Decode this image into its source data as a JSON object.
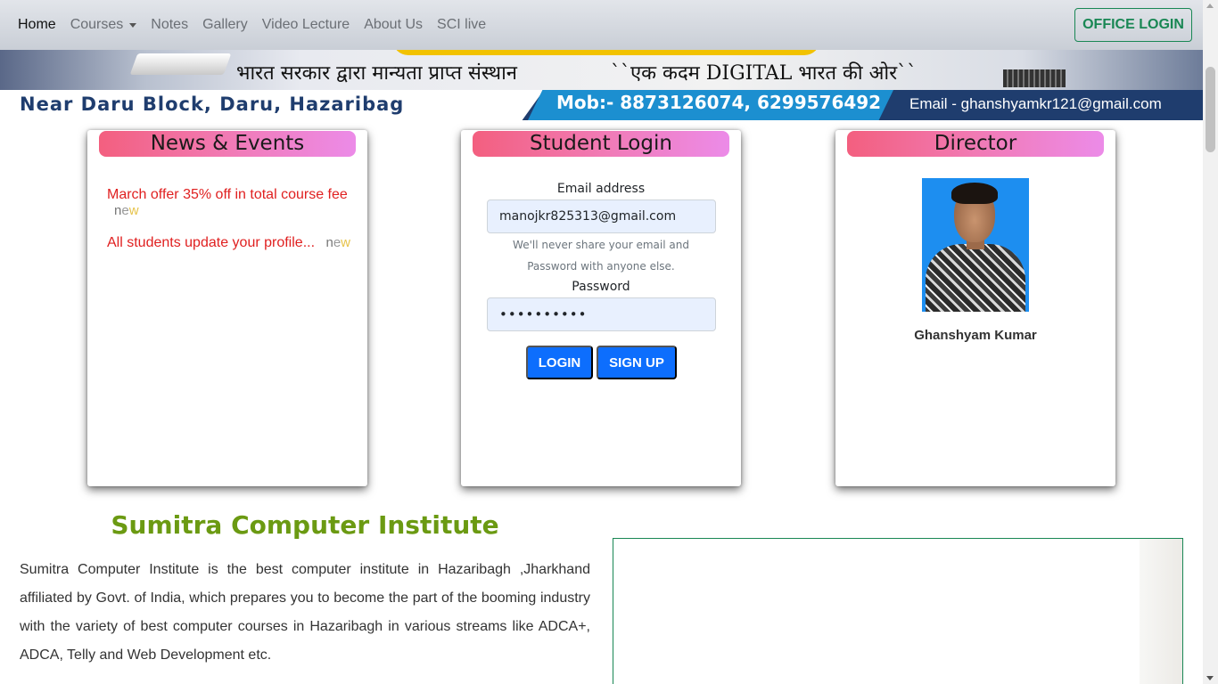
{
  "navbar": {
    "items": [
      {
        "label": "Home",
        "active": true
      },
      {
        "label": "Courses",
        "dropdown": true
      },
      {
        "label": "Notes"
      },
      {
        "label": "Gallery"
      },
      {
        "label": "Video Lecture"
      },
      {
        "label": "About Us"
      },
      {
        "label": "SCI live"
      }
    ],
    "office_login_label": "OFFICE LOGIN"
  },
  "banner": {
    "hindi_left": "भारत सरकार द्वारा मान्यता प्राप्त संस्थान",
    "hindi_right": "``एक कदम DIGITAL भारत की ओर``",
    "address": "Near Daru Block, Daru, Hazaribag",
    "mobile": "Mob:- 8873126074, 6299576492",
    "email": "Email - ghanshyamkr121@gmail.com"
  },
  "news": {
    "title": "News & Events",
    "items": [
      {
        "text": "March offer 35% off in total course fee",
        "tag": "new"
      },
      {
        "text": "All students update your profile...",
        "tag": "new"
      }
    ]
  },
  "login": {
    "title": "Student Login",
    "email_label": "Email address",
    "email_value": "manojkr825313@gmail.com",
    "help_text": "We'll never share your email and Password with anyone else.",
    "password_label": "Password",
    "password_value": "••••••••••",
    "login_label": "LOGIN",
    "signup_label": "SIGN UP"
  },
  "director": {
    "title": "Director",
    "name": "Ghanshyam Kumar"
  },
  "about": {
    "title": "Sumitra Computer Institute",
    "text": "Sumitra Computer Institute is the best computer institute in Hazaribagh ,Jharkhand affiliated by Govt. of India, which prepares you to become the part of the booming industry with the variety of best computer courses in Hazaribagh in various streams like ADCA+, ADCA, Telly and Web Development etc."
  },
  "colors": {
    "accent_green": "#198754",
    "primary_blue": "#0d6efd",
    "news_red": "#e02020",
    "title_green": "#6b9a12"
  }
}
